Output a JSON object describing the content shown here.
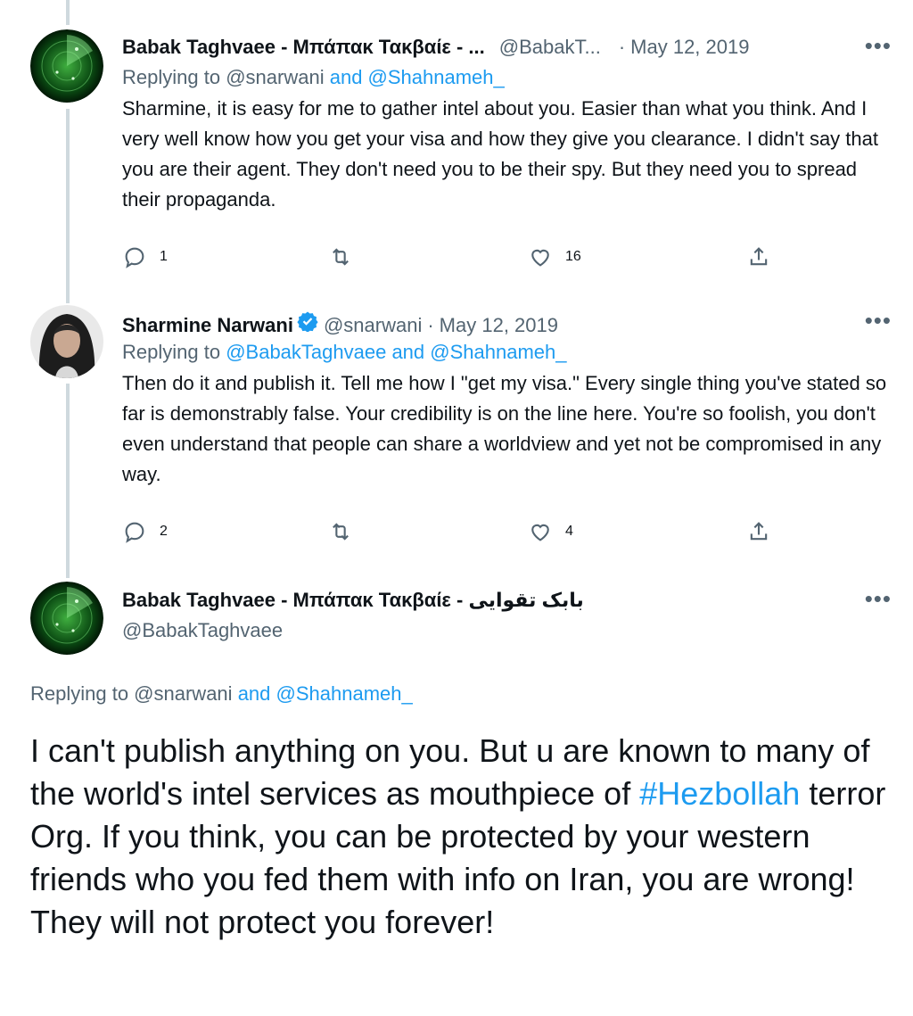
{
  "tweets": [
    {
      "name": "Babak Taghvaee - Μπάπακ Τακβαίε - ...",
      "handle": "@BabakT...",
      "date": "May 12, 2019",
      "reply_prefix": "Replying to",
      "reply_user1": "@snarwani",
      "reply_rest": "and @Shahnameh_",
      "text": "Sharmine, it is easy for me to gather intel about you. Easier than what you think. And I very well know how you get your visa and how they give you clearance. I didn't say that you are their agent. They don't need you to be their spy. But they need you to spread their propaganda.",
      "replies": "1",
      "likes": "16"
    },
    {
      "name": "Sharmine Narwani",
      "handle": "@snarwani",
      "date": "May 12, 2019",
      "reply_prefix": "Replying to",
      "reply_rest": "@BabakTaghvaee and @Shahnameh_",
      "text": "Then do it and publish it. Tell me how I \"get my visa.\" Every single thing you've stated so far is demonstrably false. Your credibility is on the line here. You're so foolish, you don't even understand that people can share a worldview and yet not be compromised in any way.",
      "replies": "2",
      "likes": "4"
    }
  ],
  "main_tweet": {
    "name": "Babak Taghvaee - Μπάπακ Τακβαίε - بابک تقوایی",
    "handle": "@BabakTaghvaee",
    "reply_prefix": "Replying to @snarwani",
    "reply_rest": "and @Shahnameh_",
    "text_part1": "I can't publish anything on you. But u are known to many of the world's intel services as mouthpiece of ",
    "hashtag": "#Hezbollah",
    "text_part2": " terror Org. If you think, you can be protected by your western friends who you fed them with info on Iran, you are wrong! They will not protect you forever!"
  },
  "more_label": "•••",
  "separator": "·",
  "colors": {
    "link": "#1d9bf0",
    "secondary": "#536471",
    "verified": "#1d9bf0"
  }
}
